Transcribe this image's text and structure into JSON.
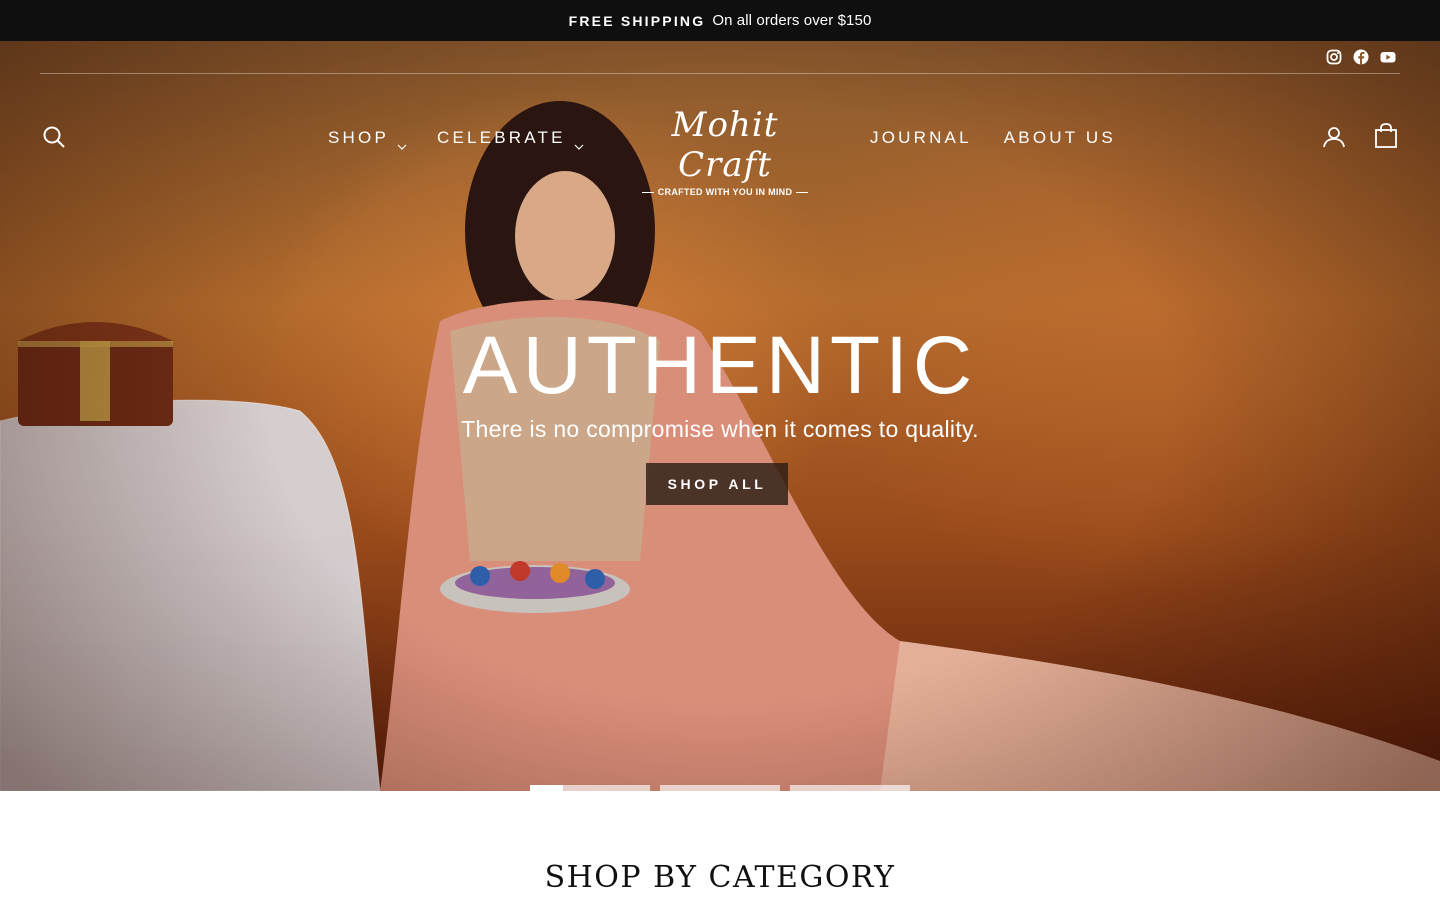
{
  "announcement": {
    "strong": "FREE SHIPPING",
    "text": "On all orders over $150"
  },
  "social": [
    {
      "icon": "instagram-icon"
    },
    {
      "icon": "facebook-icon"
    },
    {
      "icon": "youtube-icon"
    }
  ],
  "nav": {
    "shop": "SHOP",
    "celebrate": "CELEBRATE",
    "journal": "JOURNAL",
    "about": "ABOUT US"
  },
  "logo": {
    "name": "Mohit Craft",
    "tagline": "CRAFTED WITH YOU IN MIND"
  },
  "hero": {
    "headline": "AUTHENTIC",
    "subheadline": "There is no compromise when it comes to quality.",
    "cta": "SHOP ALL",
    "slides": 3,
    "active_slide": 1
  },
  "section": {
    "title": "SHOP BY CATEGORY"
  },
  "colors": {
    "announcement_bg": "#0f0f0f",
    "cta_bg": "#2d1e16",
    "hero_tone": "#b26a2c"
  }
}
